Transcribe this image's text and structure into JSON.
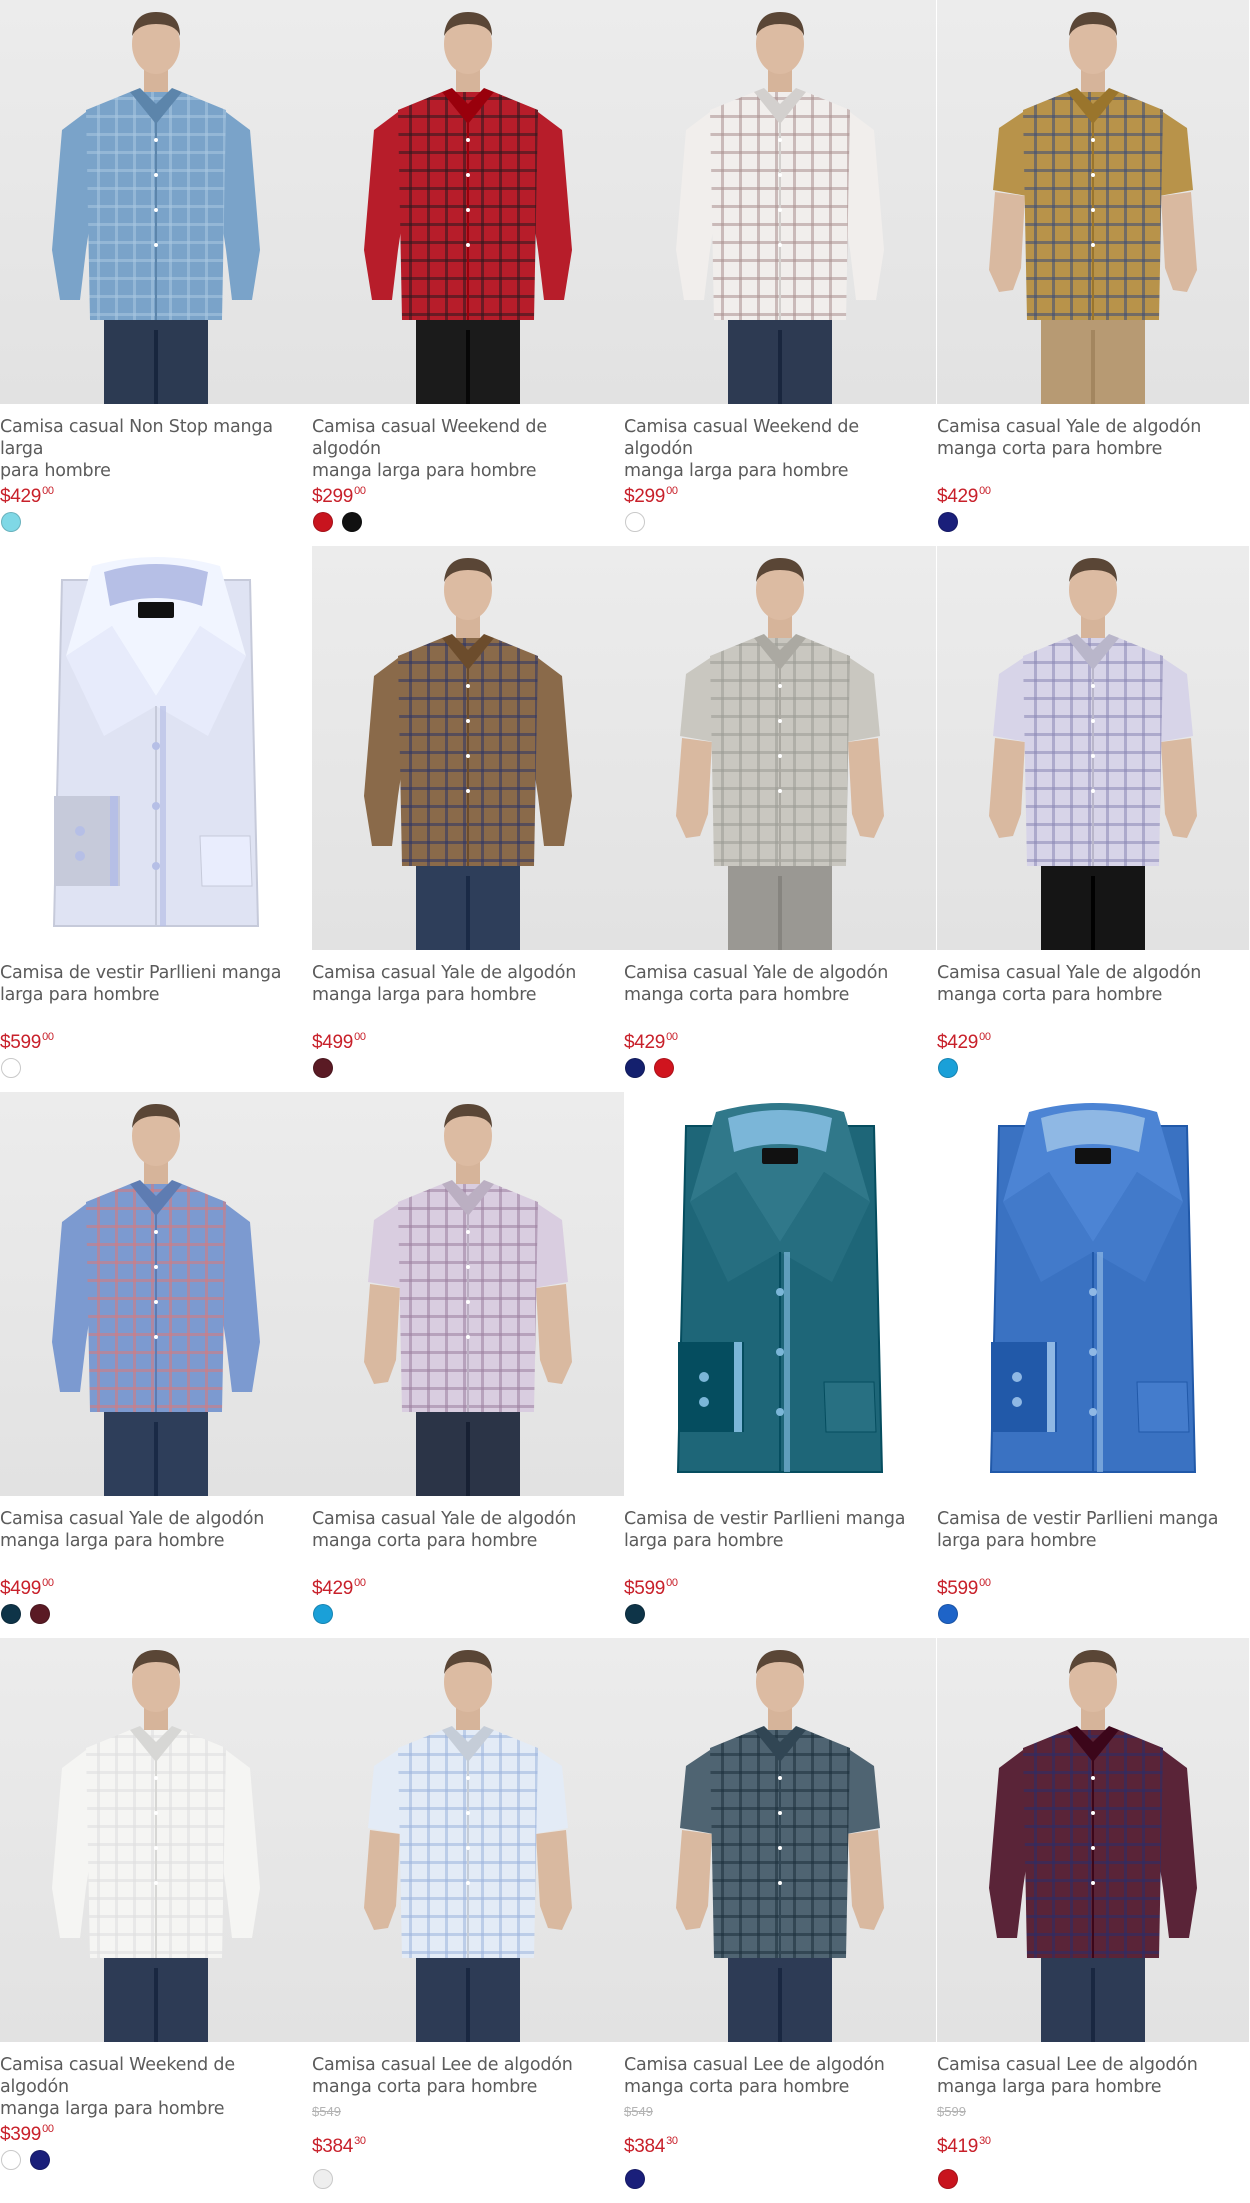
{
  "products": [
    {
      "title": "Camisa casual Non Stop manga larga\npara hombre",
      "price_int": "$429",
      "price_dec": "00",
      "kind": "model",
      "shirt": "#7aa3c9",
      "accent": "#a9c7e0",
      "pants": "#2c3a52",
      "sleeve": "long",
      "swatches": [
        "#7fd8e6"
      ]
    },
    {
      "title": "Camisa casual Weekend de algodón\nmanga larga para hombre",
      "price_int": "$299",
      "price_dec": "00",
      "kind": "model",
      "shirt": "#b71d2a",
      "accent": "#2a1a1e",
      "pants": "#1b1b1b",
      "sleeve": "long",
      "swatches": [
        "#c8141e",
        "#111111"
      ]
    },
    {
      "title": "Camisa casual Weekend de algodón\nmanga larga para hombre",
      "price_int": "$299",
      "price_dec": "00",
      "kind": "model",
      "shirt": "#f1eeec",
      "accent": "#a99090",
      "pants": "#2d3a52",
      "sleeve": "long",
      "swatches": [
        "#ffffff"
      ]
    },
    {
      "title": "Camisa casual Yale de algodón\nmanga corta para hombre",
      "price_int": "$429",
      "price_dec": "00",
      "kind": "model",
      "shirt": "#b8934a",
      "accent": "#3b4d7a",
      "pants": "#b79a73",
      "sleeve": "short",
      "swatches": [
        "#1a1f7a"
      ]
    },
    {
      "title": "Camisa de vestir Parllieni manga\nlarga para hombre",
      "price_int": "$599",
      "price_dec": "00",
      "kind": "folded",
      "shirt": "#dfe3f3",
      "accent": "#b6bfe6",
      "pants": "",
      "sleeve": "long",
      "swatches": [
        "#ffffff"
      ]
    },
    {
      "title": "Camisa casual Yale de algodón\nmanga larga para hombre",
      "price_int": "$499",
      "price_dec": "00",
      "kind": "model",
      "shirt": "#8a6a4a",
      "accent": "#2d3566",
      "pants": "#2e3e5a",
      "sleeve": "long",
      "swatches": [
        "#5a1a24"
      ]
    },
    {
      "title": "Camisa casual Yale de algodón\nmanga corta para hombre",
      "price_int": "$429",
      "price_dec": "00",
      "kind": "model",
      "shirt": "#c9c7c0",
      "accent": "#9a9a94",
      "pants": "#9a9893",
      "sleeve": "short",
      "swatches": [
        "#14206e",
        "#d0141e"
      ]
    },
    {
      "title": "Camisa casual Yale de algodón\nmanga corta para hombre",
      "price_int": "$429",
      "price_dec": "00",
      "kind": "model",
      "shirt": "#d7d4e8",
      "accent": "#8a86b4",
      "pants": "#151515",
      "sleeve": "short",
      "swatches": [
        "#1aa0d8"
      ]
    },
    {
      "title": "Camisa casual Yale de algodón\nmanga larga para hombre",
      "price_int": "$499",
      "price_dec": "00",
      "kind": "model",
      "shirt": "#7c9ad0",
      "accent": "#d97a7a",
      "pants": "#2e3e5a",
      "sleeve": "long",
      "swatches": [
        "#0e3448",
        "#5a1a24"
      ]
    },
    {
      "title": "Camisa casual Yale de algodón\nmanga corta para hombre",
      "price_int": "$429",
      "price_dec": "00",
      "kind": "model",
      "shirt": "#d9cde0",
      "accent": "#9b7f9e",
      "pants": "#2b3447",
      "sleeve": "short",
      "swatches": [
        "#1aa0d8"
      ]
    },
    {
      "title": "Camisa de vestir Parllieni manga\nlarga para hombre",
      "price_int": "$599",
      "price_dec": "00",
      "kind": "folded",
      "shirt": "#1e6678",
      "accent": "#7bb6d8",
      "pants": "",
      "sleeve": "long",
      "swatches": [
        "#0e3448"
      ]
    },
    {
      "title": "Camisa de vestir Parllieni manga\nlarga para hombre",
      "price_int": "$599",
      "price_dec": "00",
      "kind": "folded",
      "shirt": "#3a72c2",
      "accent": "#8fb8e4",
      "pants": "",
      "sleeve": "long",
      "swatches": [
        "#1e64c8"
      ]
    },
    {
      "title": "Camisa casual Weekend de algodón\nmanga larga para hombre",
      "price_int": "$399",
      "price_dec": "00",
      "kind": "model",
      "shirt": "#f5f5f3",
      "accent": "#dedede",
      "pants": "#2d3b55",
      "sleeve": "long",
      "swatches": [
        "#ffffff",
        "#1a1f7a"
      ]
    },
    {
      "title": "Camisa casual Lee de algodón\nmanga corta para hombre",
      "old_price": "$549",
      "price_int": "$384",
      "price_dec": "30",
      "kind": "model",
      "shirt": "#e3ebf6",
      "accent": "#9db4dc",
      "pants": "#2d3b55",
      "sleeve": "short",
      "swatches": [
        "#eeeeee"
      ]
    },
    {
      "title": "Camisa casual Lee de algodón\nmanga corta para hombre",
      "old_price": "$549",
      "price_int": "$384",
      "price_dec": "30",
      "kind": "model",
      "shirt": "#4f6472",
      "accent": "#1c2f3c",
      "pants": "#2d3b55",
      "sleeve": "short",
      "swatches": [
        "#1a1f7a"
      ]
    },
    {
      "title": "Camisa casual Lee de algodón\nmanga larga para hombre",
      "old_price": "$599",
      "price_int": "$419",
      "price_dec": "30",
      "kind": "model",
      "shirt": "#5a2438",
      "accent": "#2a2d6a",
      "pants": "#2d3b55",
      "sleeve": "long",
      "swatches": [
        "#c8141e"
      ]
    }
  ]
}
